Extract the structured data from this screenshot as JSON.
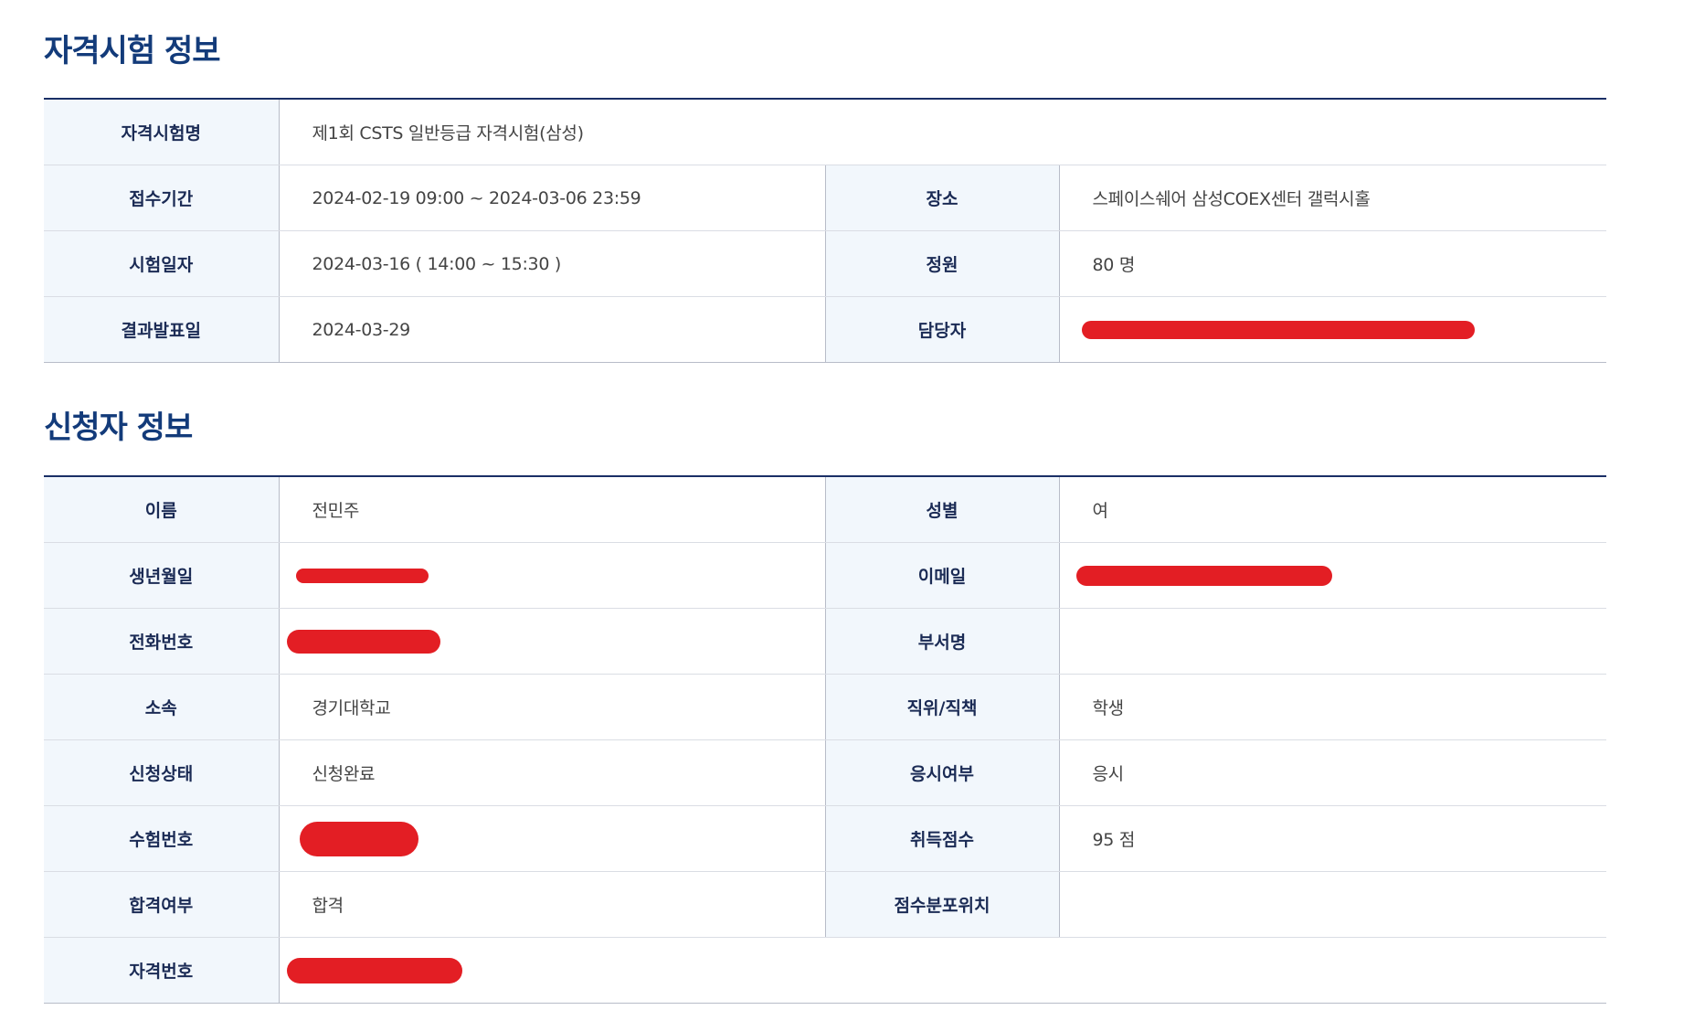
{
  "exam_section": {
    "title": "자격시험 정보",
    "exam_name": {
      "label": "자격시험명",
      "value": "제1회 CSTS 일반등급 자격시험(삼성)"
    },
    "reception_period": {
      "label": "접수기간",
      "value": "2024-02-19 09:00 ~ 2024-03-06 23:59"
    },
    "venue": {
      "label": "장소",
      "value": "스페이스쉐어 삼성COEX센터 갤럭시홀"
    },
    "exam_date": {
      "label": "시험일자",
      "value": "2024-03-16 ( 14:00 ~ 15:30 )"
    },
    "capacity": {
      "label": "정원",
      "value": "80 명"
    },
    "result_date": {
      "label": "결과발표일",
      "value": "2024-03-29"
    },
    "manager": {
      "label": "담당자",
      "value": ""
    }
  },
  "applicant_section": {
    "title": "신청자 정보",
    "name": {
      "label": "이름",
      "value": "전민주"
    },
    "gender": {
      "label": "성별",
      "value": "여"
    },
    "birth": {
      "label": "생년월일",
      "value": ""
    },
    "email": {
      "label": "이메일",
      "value": ""
    },
    "phone": {
      "label": "전화번호",
      "value": ""
    },
    "department": {
      "label": "부서명",
      "value": ""
    },
    "affiliation": {
      "label": "소속",
      "value": "경기대학교"
    },
    "position": {
      "label": "직위/직책",
      "value": "학생"
    },
    "status": {
      "label": "신청상태",
      "value": "신청완료"
    },
    "attendance": {
      "label": "응시여부",
      "value": "응시"
    },
    "exam_number": {
      "label": "수험번호",
      "value": ""
    },
    "score": {
      "label": "취득점수",
      "value": "95 점"
    },
    "pass": {
      "label": "합격여부",
      "value": "합격"
    },
    "score_position": {
      "label": "점수분포위치",
      "value": ""
    },
    "cert_number": {
      "label": "자격번호",
      "value": ""
    }
  },
  "colors": {
    "title": "#133b7a",
    "label_bg": "#f2f7fc",
    "redaction": "#e31e24"
  }
}
